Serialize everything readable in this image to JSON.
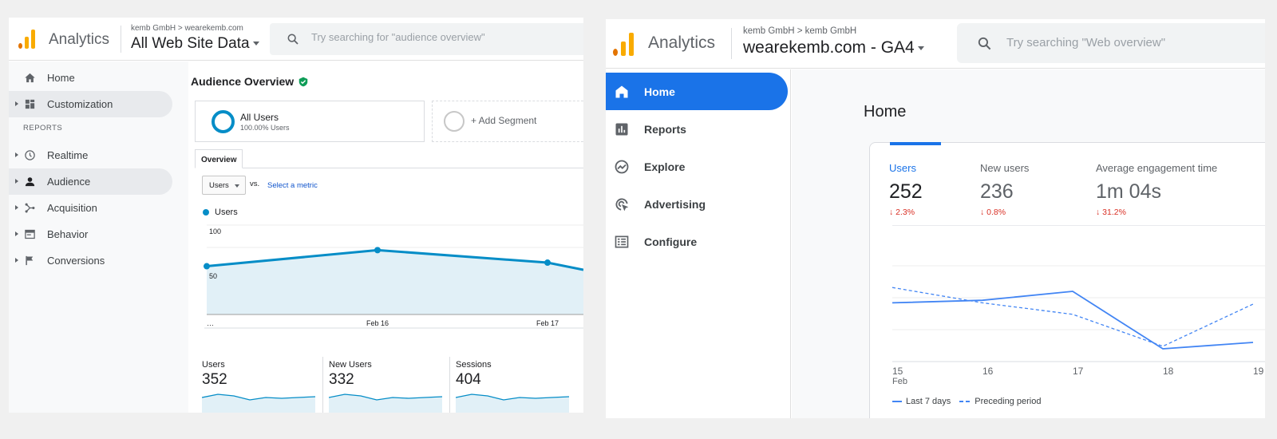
{
  "ua": {
    "header": {
      "app_name": "Analytics",
      "breadcrumb": "kemb GmbH > wearekemb.com",
      "property": "All Web Site Data",
      "search_placeholder": "Try searching for \"audience overview\""
    },
    "sidebar": {
      "reports_heading": "REPORTS",
      "items": [
        {
          "label": "Home",
          "icon": "home-icon"
        },
        {
          "label": "Customization",
          "icon": "dashboard-icon"
        },
        {
          "label": "Realtime",
          "icon": "clock-icon"
        },
        {
          "label": "Audience",
          "icon": "person-icon"
        },
        {
          "label": "Acquisition",
          "icon": "acquisition-icon"
        },
        {
          "label": "Behavior",
          "icon": "behavior-icon"
        },
        {
          "label": "Conversions",
          "icon": "flag-icon"
        }
      ]
    },
    "main": {
      "title": "Audience Overview",
      "segment": {
        "name": "All Users",
        "share": "100.00% Users"
      },
      "add_segment": "+ Add Segment",
      "tab": "Overview",
      "metric_select": "Users",
      "vs": "vs.",
      "select_metric": "Select a metric",
      "legend": "Users",
      "accent_color": "#058dc7",
      "kpis": [
        {
          "label": "Users",
          "value": "352"
        },
        {
          "label": "New Users",
          "value": "332"
        },
        {
          "label": "Sessions",
          "value": "404"
        }
      ]
    }
  },
  "ga4": {
    "header": {
      "app_name": "Analytics",
      "breadcrumb": "kemb GmbH > kemb GmbH",
      "property": "wearekemb.com - GA4",
      "search_placeholder": "Try searching \"Web overview\""
    },
    "sidebar": {
      "items": [
        {
          "label": "Home",
          "icon": "home-icon",
          "active": true
        },
        {
          "label": "Reports",
          "icon": "reports-icon"
        },
        {
          "label": "Explore",
          "icon": "explore-icon"
        },
        {
          "label": "Advertising",
          "icon": "advertising-icon"
        },
        {
          "label": "Configure",
          "icon": "configure-icon"
        }
      ]
    },
    "main": {
      "title": "Home",
      "accent_color": "#1a73e8",
      "kpis": [
        {
          "label": "Users",
          "value": "252",
          "delta": "↓ 2.3%"
        },
        {
          "label": "New users",
          "value": "236",
          "delta": "↓ 0.8%"
        },
        {
          "label": "Average engagement time",
          "value": "1m 04s",
          "delta": "↓ 31.2%"
        }
      ],
      "legend": {
        "current": "Last 7 days",
        "previous": "Preceding period"
      }
    }
  },
  "chart_data": [
    {
      "type": "area",
      "series": [
        {
          "name": "Users",
          "values": [
            54,
            72,
            58,
            50
          ]
        }
      ],
      "x": [
        "…",
        "Feb 16",
        "Feb 17",
        ""
      ],
      "ytick_labels": [
        "100",
        "50"
      ],
      "ylim": [
        0,
        100
      ],
      "grid": true
    },
    {
      "type": "line",
      "x_ticks": [
        "15",
        "16",
        "17",
        "18",
        "19"
      ],
      "x_sub_label": "Feb",
      "series": [
        {
          "name": "Last 7 days",
          "values": [
            46,
            48,
            55,
            10,
            15
          ],
          "style": "solid"
        },
        {
          "name": "Preceding period",
          "values": [
            58,
            46,
            37,
            12,
            45
          ],
          "style": "dashed"
        }
      ],
      "ylim": [
        0,
        100
      ],
      "grid": true
    }
  ]
}
